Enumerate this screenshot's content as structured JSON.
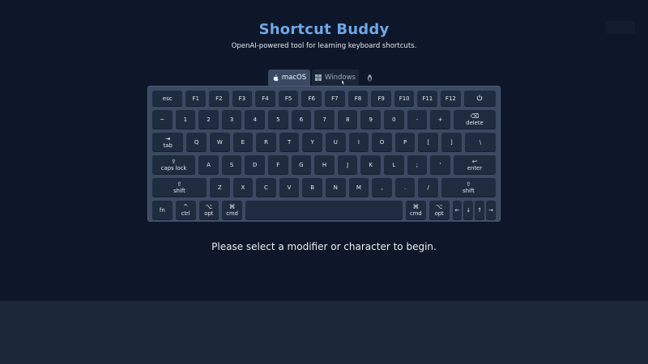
{
  "header": {
    "title": "Shortcut Buddy",
    "subtitle": "OpenAI-powered tool for learning keyboard shortcuts."
  },
  "tabs": [
    {
      "label": "macOS",
      "icon": "apple-icon",
      "active": true
    },
    {
      "label": "Windows",
      "icon": "windows-icon",
      "active": false
    },
    {
      "label": "",
      "icon": "linux-penguin-icon",
      "active": false
    }
  ],
  "keyboard": {
    "row1": [
      "esc",
      "F1",
      "F2",
      "F3",
      "F4",
      "F5",
      "F6",
      "F7",
      "F8",
      "F9",
      "F10",
      "F11",
      "F12"
    ],
    "row2": [
      "~",
      "1",
      "2",
      "3",
      "4",
      "5",
      "6",
      "7",
      "8",
      "9",
      "0",
      "-",
      "+"
    ],
    "delete": {
      "symbol": "⌫",
      "label": "delete"
    },
    "tab": {
      "symbol": "⇥",
      "label": "tab"
    },
    "row3": [
      "Q",
      "W",
      "E",
      "R",
      "T",
      "Y",
      "U",
      "I",
      "O",
      "P",
      "[",
      "]",
      "\\"
    ],
    "caps": {
      "symbol": "⇪",
      "label": "caps lock"
    },
    "row4": [
      "A",
      "S",
      "D",
      "F",
      "G",
      "H",
      "J",
      "K",
      "L",
      ";",
      "'"
    ],
    "enter": {
      "symbol": "↩",
      "label": "enter"
    },
    "shift_left": {
      "symbol": "⇧",
      "label": "shift"
    },
    "row5": [
      "Z",
      "X",
      "C",
      "V",
      "B",
      "N",
      "M",
      ",",
      ".",
      "/"
    ],
    "shift_right": {
      "symbol": "⇧",
      "label": "shift"
    },
    "fn": "fn",
    "ctrl": {
      "symbol": "^",
      "label": "ctrl"
    },
    "opt_left": {
      "symbol": "⌥",
      "label": "opt"
    },
    "cmd_left": {
      "symbol": "⌘",
      "label": "cmd"
    },
    "cmd_right": {
      "symbol": "⌘",
      "label": "cmd"
    },
    "opt_right": {
      "symbol": "⌥",
      "label": "opt"
    },
    "arrows": [
      "←",
      "↓",
      "↑",
      "→"
    ]
  },
  "message": "Please select a modifier or character to begin.",
  "colors": {
    "background": "#0e1729",
    "title": "#6fa7e8",
    "keyboard": "#3b4a62",
    "key": "#1f2c40",
    "footer": "#1c2738"
  }
}
